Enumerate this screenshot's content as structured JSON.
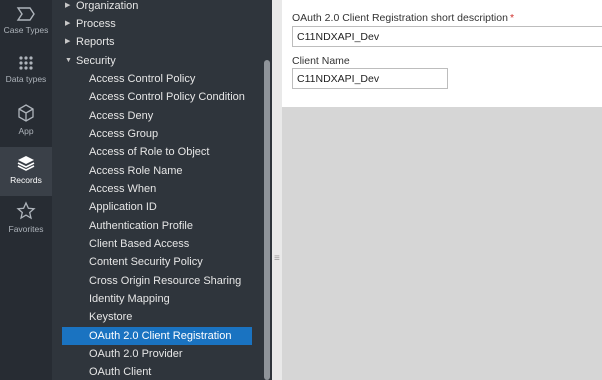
{
  "rail": {
    "items": [
      {
        "label": "Case Types",
        "icon": "case-types-icon"
      },
      {
        "label": "Data types",
        "icon": "data-types-icon"
      },
      {
        "label": "App",
        "icon": "app-cube-icon"
      },
      {
        "label": "Records",
        "icon": "records-stack-icon",
        "active": true
      },
      {
        "label": "Favorites",
        "icon": "star-icon"
      }
    ]
  },
  "tree": {
    "categories": [
      {
        "label": "Organization",
        "expanded": false
      },
      {
        "label": "Process",
        "expanded": false
      },
      {
        "label": "Reports",
        "expanded": false
      },
      {
        "label": "Security",
        "expanded": true
      }
    ],
    "security_items": [
      "Access Control Policy",
      "Access Control Policy Condition",
      "Access Deny",
      "Access Group",
      "Access of Role to Object",
      "Access Role Name",
      "Access When",
      "Application ID",
      "Authentication Profile",
      "Client Based Access",
      "Content Security Policy",
      "Cross Origin Resource Sharing",
      "Identity Mapping",
      "Keystore",
      "OAuth 2.0 Client Registration",
      "OAuth 2.0 Provider",
      "OAuth Client"
    ],
    "selected_item": "OAuth 2.0 Client Registration"
  },
  "form": {
    "short_description_label": "OAuth 2.0 Client Registration short description",
    "required_marker": "*",
    "short_description_value": "C11NDXAPI_Dev",
    "client_name_label": "Client Name",
    "client_name_value": "C11NDXAPI_Dev"
  },
  "colors": {
    "rail_bg": "#272c33",
    "tree_bg": "#2f353c",
    "selected": "#1a73c1",
    "required": "#d0312d"
  }
}
